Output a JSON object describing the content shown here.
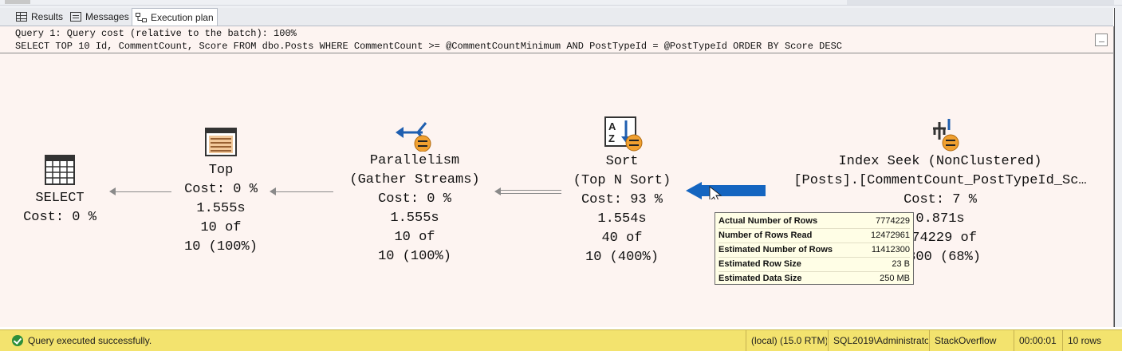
{
  "tabs": [
    {
      "label": "Results",
      "icon": "grid-icon"
    },
    {
      "label": "Messages",
      "icon": "message-icon"
    },
    {
      "label": "Execution plan",
      "icon": "plan-icon"
    }
  ],
  "header": {
    "line1": "Query 1: Query cost (relative to the batch): 100%",
    "line2": "SELECT TOP 10 Id, CommentCount, Score FROM dbo.Posts WHERE CommentCount >= @CommentCountMinimum AND PostTypeId = @PostTypeId ORDER BY Score DESC"
  },
  "operators": {
    "select": {
      "lines": [
        "SELECT",
        "Cost: 0 %"
      ]
    },
    "top": {
      "lines": [
        "Top",
        "Cost: 0 %",
        "1.555s",
        "10 of",
        "10 (100%)"
      ]
    },
    "parallelism": {
      "lines": [
        "Parallelism",
        "(Gather Streams)",
        "Cost: 0 %",
        "1.555s",
        "10 of",
        "10 (100%)"
      ]
    },
    "sort": {
      "lines": [
        "Sort",
        "(Top N Sort)",
        "Cost: 93 %",
        "1.554s",
        "40 of",
        "10 (400%)"
      ]
    },
    "seek": {
      "lines": [
        "Index Seek (NonClustered)",
        "[Posts].[CommentCount_PostTypeId_Sc…",
        "Cost: 7 %",
        "0.871s",
        "774229 of",
        "2300 (68%)"
      ]
    }
  },
  "tooltip": [
    {
      "label": "Actual Number of Rows",
      "value": "7774229"
    },
    {
      "label": "Number of Rows Read",
      "value": "12472961"
    },
    {
      "label": "Estimated Number of Rows",
      "value": "11412300"
    },
    {
      "label": "Estimated Row Size",
      "value": "23 B"
    },
    {
      "label": "Estimated Data Size",
      "value": "250 MB"
    }
  ],
  "status": {
    "message": "Query executed successfully.",
    "server": "(local) (15.0 RTM)",
    "login": "SQL2019\\Administrator ...",
    "database": "StackOverflow",
    "elapsed": "00:00:01",
    "rows": "10 rows"
  },
  "colors": {
    "pane_bg": "#fdf4f1",
    "status_bg": "#f3e36e",
    "arrow_blue": "#1565c0",
    "badge": "#f0a030"
  }
}
